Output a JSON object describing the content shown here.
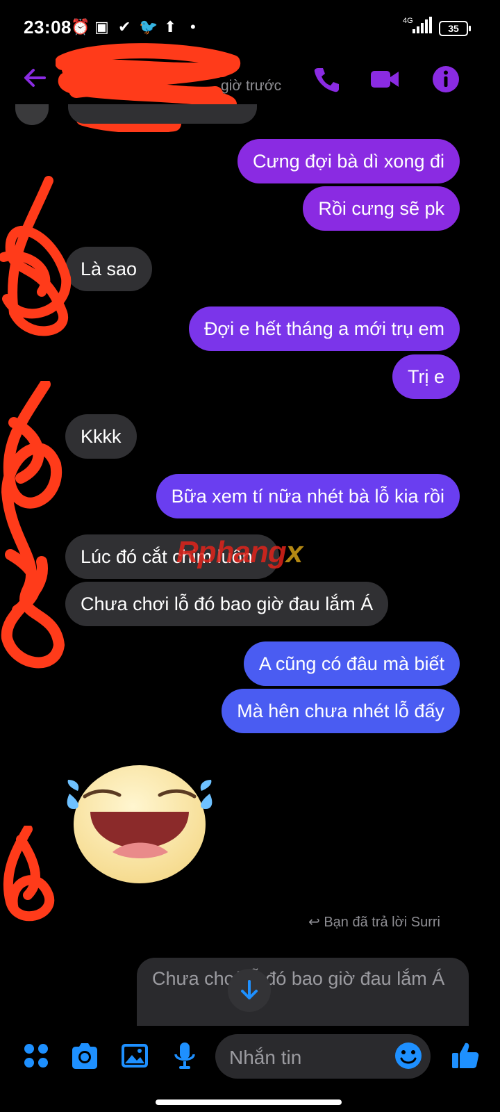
{
  "status_bar": {
    "time": "23:08",
    "network": "4G",
    "battery": "35"
  },
  "header": {
    "subtitle": "giờ trước"
  },
  "messages": [
    {
      "side": "out",
      "text": "Cưng đợi bà dì xong đi"
    },
    {
      "side": "out",
      "text": "Rồi cưng sẽ pk"
    },
    {
      "side": "in",
      "text": "Là sao"
    },
    {
      "side": "out",
      "text": "Đợi e hết tháng a mới trụ em"
    },
    {
      "side": "out",
      "text": "Trị e"
    },
    {
      "side": "in",
      "text": "Kkkk"
    },
    {
      "side": "out",
      "text": "Bữa xem tí nữa nhét bà lỗ kia rồi"
    },
    {
      "side": "in",
      "text": "Lúc đó cắt chim luôn"
    },
    {
      "side": "in",
      "text": "Chưa chơi lỗ đó bao giờ đau lắm Á"
    },
    {
      "side": "out",
      "text": "A cũng có đâu mà biết"
    },
    {
      "side": "out",
      "text": "Mà hên chưa nhét lỗ đấy"
    }
  ],
  "sticker": {
    "name": "laughing-tears-emoji"
  },
  "reply": {
    "hint": "Bạn đã trả lời Surri",
    "quoted_text": "Chưa chơi lỗ đó bao giờ đau lắm Á"
  },
  "composer": {
    "placeholder": "Nhắn tin"
  },
  "watermark": {
    "part1": "Rphang",
    "part2": "x"
  },
  "colors": {
    "accent": "#8a2be2",
    "bubble_in": "#303033",
    "icon_blue": "#1e90ff",
    "redaction": "#ff3b1a"
  }
}
